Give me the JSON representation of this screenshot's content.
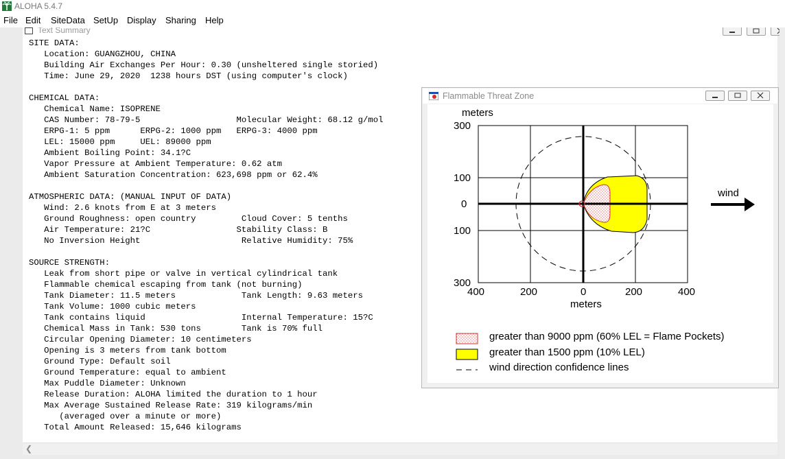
{
  "app": {
    "title": "ALOHA 5.4.7"
  },
  "menu": [
    "File",
    "Edit",
    "SiteData",
    "SetUp",
    "Display",
    "Sharing",
    "Help"
  ],
  "text_summary": {
    "title": "Text Summary",
    "lines": [
      "SITE DATA:",
      "   Location: GUANGZHOU, CHINA",
      "   Building Air Exchanges Per Hour: 0.30 (unsheltered single storied)",
      "   Time: June 29, 2020  1238 hours DST (using computer's clock)",
      "",
      "CHEMICAL DATA:",
      "   Chemical Name: ISOPRENE",
      "   CAS Number: 78-79-5                   Molecular Weight: 68.12 g/mol",
      "   ERPG-1: 5 ppm      ERPG-2: 1000 ppm   ERPG-3: 4000 ppm",
      "   LEL: 15000 ppm     UEL: 89000 ppm",
      "   Ambient Boiling Point: 34.1?C",
      "   Vapor Pressure at Ambient Temperature: 0.62 atm",
      "   Ambient Saturation Concentration: 623,698 ppm or 62.4%",
      "",
      "ATMOSPHERIC DATA: (MANUAL INPUT OF DATA)",
      "   Wind: 2.6 knots from E at 3 meters",
      "   Ground Roughness: open country         Cloud Cover: 5 tenths",
      "   Air Temperature: 21?C                 Stability Class: B",
      "   No Inversion Height                    Relative Humidity: 75%",
      "",
      "SOURCE STRENGTH:",
      "   Leak from short pipe or valve in vertical cylindrical tank",
      "   Flammable chemical escaping from tank (not burning)",
      "   Tank Diameter: 11.5 meters             Tank Length: 9.63 meters",
      "   Tank Volume: 1000 cubic meters",
      "   Tank contains liquid                   Internal Temperature: 15?C",
      "   Chemical Mass in Tank: 530 tons        Tank is 70% full",
      "   Circular Opening Diameter: 10 centimeters",
      "   Opening is 3 meters from tank bottom",
      "   Ground Type: Default soil",
      "   Ground Temperature: equal to ambient",
      "   Max Puddle Diameter: Unknown",
      "   Release Duration: ALOHA limited the duration to 1 hour",
      "   Max Average Sustained Release Rate: 319 kilograms/min",
      "      (averaged over a minute or more)",
      "   Total Amount Released: 15,646 kilograms"
    ]
  },
  "threat_zone": {
    "title": "Flammable Threat Zone",
    "y_unit_label": "meters",
    "x_unit_label": "meters",
    "y_tick_labels": [
      "300",
      "100",
      "0",
      "100",
      "300"
    ],
    "x_tick_labels": [
      "400",
      "200",
      "0",
      "200",
      "400"
    ],
    "wind_label": "wind",
    "legend": [
      {
        "label": "greater than 9000 ppm (60% LEL = Flame Pockets)",
        "color": "#e53935",
        "fill": "dotted-pink"
      },
      {
        "label": "greater than 1500 ppm (10% LEL)",
        "color": "#ffff00",
        "fill": "yellow"
      },
      {
        "label": "wind direction confidence lines",
        "fill": "dashed-line"
      }
    ]
  },
  "colors": {
    "yellow_zone": "#ffff00",
    "red_zone_border": "#d32f2f",
    "source_marker": "#d32f2f"
  }
}
